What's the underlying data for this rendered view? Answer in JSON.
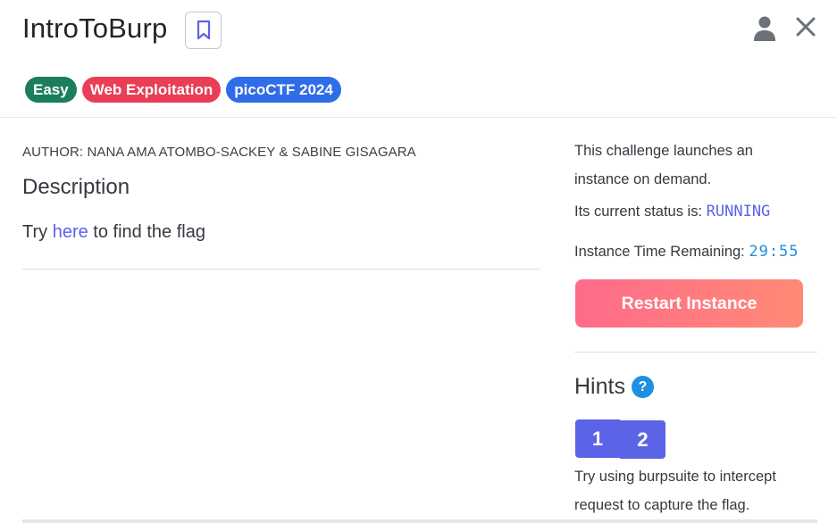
{
  "header": {
    "title": "IntroToBurp"
  },
  "tags": [
    {
      "label": "Easy",
      "color": "#1a7d5e"
    },
    {
      "label": "Web Exploitation",
      "color": "#ea3d56"
    },
    {
      "label": "picoCTF 2024",
      "color": "#2f6de8"
    }
  ],
  "content": {
    "author": "AUTHOR: NANA AMA ATOMBO-SACKEY & SABINE GISAGARA",
    "description_heading": "Description",
    "description_before_link": "Try ",
    "description_link": "here",
    "description_after_link": " to find the flag"
  },
  "instance": {
    "launch_text_line1": "This challenge launches an",
    "launch_text_line2": "instance on demand.",
    "status_label": "Its current status is: ",
    "status_value": "RUNNING",
    "time_label": "Instance Time Remaining: ",
    "time_value": "29:55",
    "restart_label": "Restart Instance"
  },
  "hints": {
    "heading": "Hints",
    "help_icon": "?",
    "tabs": [
      "1",
      "2"
    ],
    "text_line1": "Try using burpsuite to intercept",
    "text_line2": "request to capture the flag."
  },
  "icons": {
    "bookmark": "bookmark-icon",
    "user": "user-icon",
    "close": "close-icon"
  }
}
